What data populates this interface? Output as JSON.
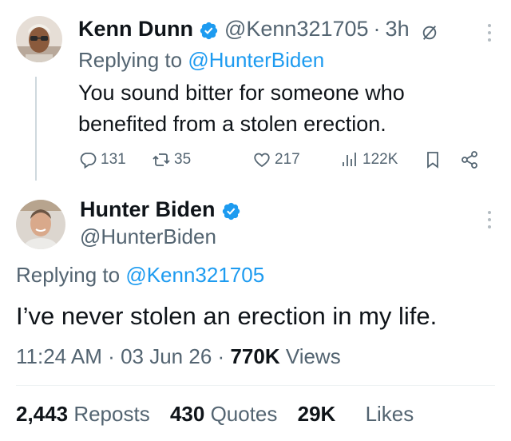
{
  "reply_tweet": {
    "author_name": "Kenn Dunn",
    "handle": "@Kenn321705",
    "separator": "·",
    "time": "3h",
    "replying_prefix": "Replying to",
    "replying_to": "@HunterBiden",
    "text": "You sound bitter for someone who benefited from a stolen erection.",
    "metrics": {
      "replies": "131",
      "reposts": "35",
      "likes": "217",
      "views": "122K"
    },
    "icons": [
      "verified-badge-icon",
      "grok-icon",
      "more-icon",
      "reply-icon",
      "repost-icon",
      "like-icon",
      "views-icon",
      "bookmark-icon",
      "share-icon"
    ]
  },
  "main_tweet": {
    "author_name": "Hunter Biden",
    "handle": "@HunterBiden",
    "replying_prefix": "Replying to",
    "replying_to": "@Kenn321705",
    "text": "I’ve never stolen an erection in my life.",
    "time": "11:24 AM",
    "sep1": "·",
    "date": "03 Jun 26",
    "sep2": "·",
    "views_count": "770K",
    "views_label": "Views",
    "stats": {
      "reposts_count": "2,443",
      "reposts_label": "Reposts",
      "quotes_count": "430",
      "quotes_label": "Quotes",
      "likes_count": "29K",
      "likes_label": "Likes"
    }
  },
  "colors": {
    "accent": "#1d9bf0",
    "text": "#0f1419",
    "muted": "#536471",
    "divider": "#eff3f4"
  }
}
